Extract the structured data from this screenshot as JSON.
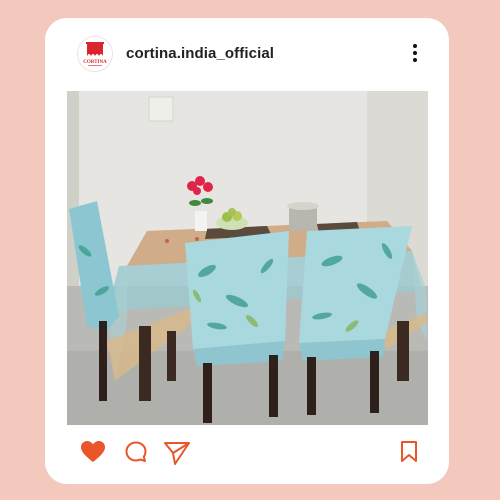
{
  "post": {
    "account": {
      "username": "cortina.india_official",
      "avatar_text": "CORTINA",
      "brand_color": "#d9262c"
    },
    "image_alt": "Dining table with leaf-print chair covers and transparent table cover",
    "actions": {
      "like_icon": "heart-icon",
      "comment_icon": "comment-icon",
      "share_icon": "send-icon",
      "save_icon": "bookmark-icon",
      "liked_color": "#e8562a",
      "icon_color": "#e8562a"
    },
    "colors": {
      "background": "#f4c9bd",
      "card": "#ffffff"
    }
  }
}
